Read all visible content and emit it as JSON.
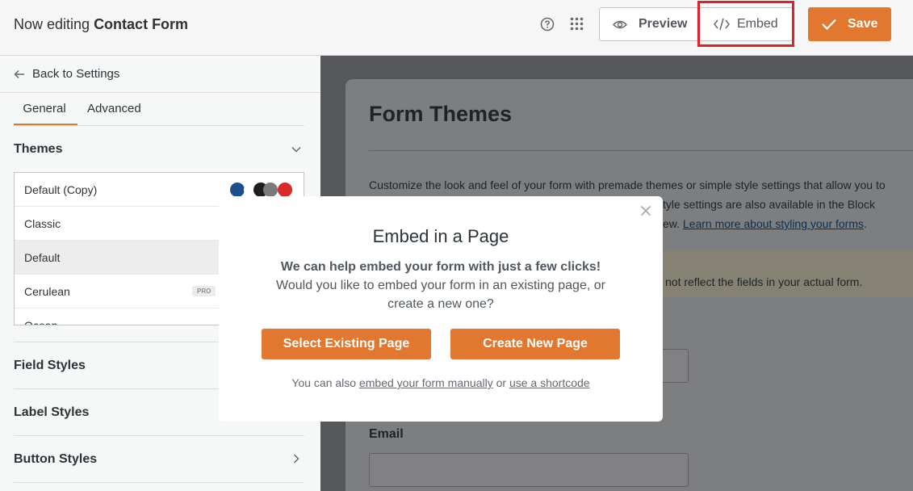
{
  "header": {
    "title_prefix": "Now editing ",
    "form_name": "Contact Form",
    "preview_label": "Preview",
    "embed_label": "Embed",
    "save_label": "Save"
  },
  "sidebar": {
    "back_label": "Back to Settings",
    "tabs": [
      "General",
      "Advanced"
    ],
    "themes_title": "Themes",
    "themes": [
      {
        "name": "Default (Copy)",
        "badge": ""
      },
      {
        "name": "Classic",
        "badge": ""
      },
      {
        "name": "Default",
        "badge": ""
      },
      {
        "name": "Cerulean",
        "badge": "PRO"
      },
      {
        "name": "Ocean",
        "badge": ""
      }
    ],
    "swatch_colors": [
      "#1d4e8f",
      "#ffffff",
      "#1e1e1e",
      "#7a7a7a",
      "#d92a2a"
    ],
    "sections": [
      "Field Styles",
      "Label Styles",
      "Button Styles"
    ]
  },
  "main": {
    "title": "Form Themes",
    "desc_line1": "Customize the look and feel of your form with premade themes or simple style settings that allow you to",
    "desc_line2": "tyle settings are also available in the Block",
    "desc_line3": "ew.",
    "desc_link": "Learn more about styling your forms",
    "desc_period": ".",
    "notice": "not reflect the fields in your actual form.",
    "email_label": "Email"
  },
  "modal": {
    "title": "Embed in a Page",
    "bold_line": "We can help embed your form with just a few clicks!",
    "line2": "Would you like to embed your form in an existing page, or",
    "line3": "create a new one?",
    "btn_existing": "Select Existing Page",
    "btn_new": "Create New Page",
    "foot_prefix": "You can also ",
    "foot_link1": "embed your form manually",
    "foot_mid": " or ",
    "foot_link2": "use a shortcode"
  },
  "colors": {
    "accent": "#e27730",
    "highlight": "#e0202a"
  }
}
